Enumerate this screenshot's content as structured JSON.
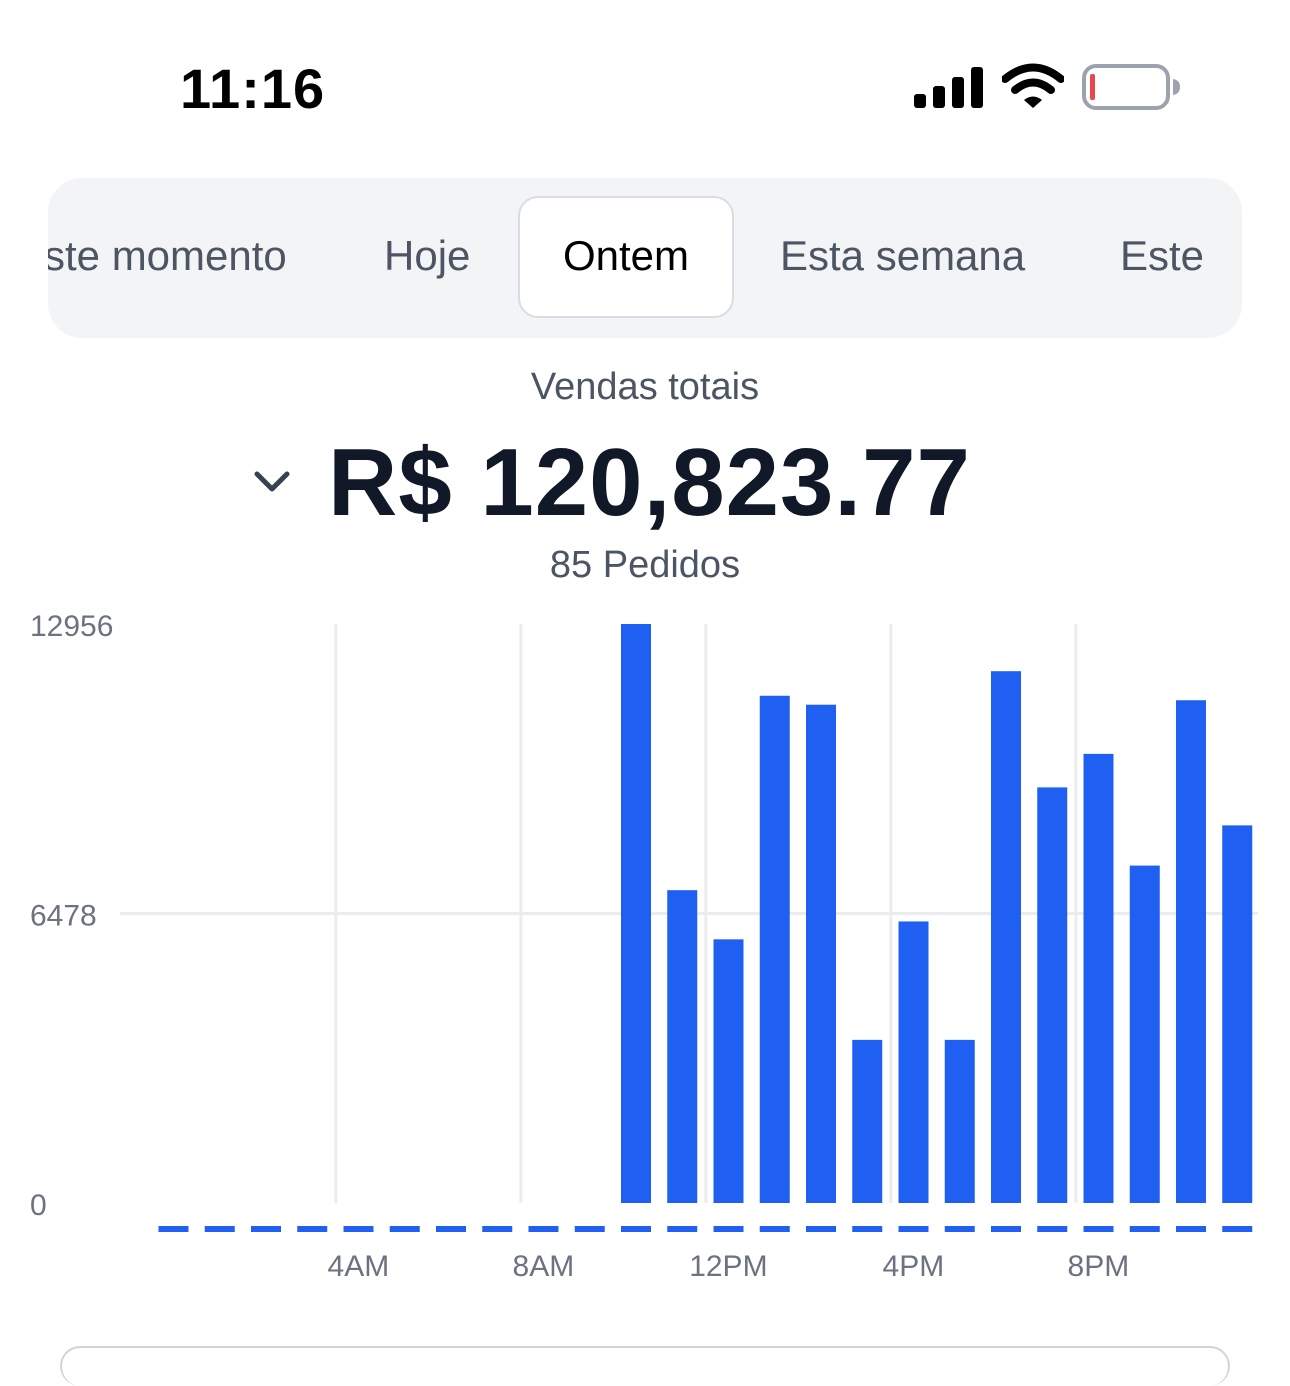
{
  "status_bar": {
    "time": "11:16",
    "icons": [
      "signal-bars-icon",
      "wifi-icon",
      "battery-low-icon"
    ],
    "battery_level": 0.05,
    "battery_color": "#e5484d"
  },
  "period_tabs": [
    {
      "label": "Este momento",
      "visible_text": "ste momento",
      "active": false
    },
    {
      "label": "Hoje",
      "visible_text": "Hoje",
      "active": false
    },
    {
      "label": "Ontem",
      "visible_text": "Ontem",
      "active": true
    },
    {
      "label": "Esta semana",
      "visible_text": "Esta semana",
      "active": false
    },
    {
      "label": "Este",
      "visible_text": "Este",
      "active": false
    }
  ],
  "summary": {
    "label": "Vendas totais",
    "value": "R$ 120,823.77",
    "orders": "85 Pedidos",
    "toggle_icon": "chevron-down-icon"
  },
  "colors": {
    "accent": "#1f5ff2",
    "grid": "#ececef",
    "muted_text": "#6b7280"
  },
  "chart_data": {
    "type": "bar",
    "x": [
      0,
      1,
      2,
      3,
      4,
      5,
      6,
      7,
      8,
      9,
      10,
      11,
      12,
      13,
      14,
      15,
      16,
      17,
      18,
      19,
      20,
      21,
      22,
      23
    ],
    "x_tick_labels": [
      {
        "at": 4,
        "label": "4AM"
      },
      {
        "at": 8,
        "label": "8AM"
      },
      {
        "at": 12,
        "label": "12PM"
      },
      {
        "at": 16,
        "label": "4PM"
      },
      {
        "at": 20,
        "label": "8PM"
      }
    ],
    "values": [
      0,
      0,
      0,
      0,
      0,
      0,
      0,
      0,
      0,
      0,
      12956,
      7000,
      5900,
      11350,
      11150,
      3650,
      6300,
      3650,
      11900,
      9300,
      10050,
      7550,
      11250,
      8450
    ],
    "y_ticks": [
      {
        "value": 0,
        "label": "0"
      },
      {
        "value": 6478,
        "label": "6478"
      },
      {
        "value": 12956,
        "label": "12956"
      }
    ],
    "ylim": [
      0,
      12956
    ],
    "title": "",
    "xlabel": "",
    "ylabel": "",
    "grid": true,
    "legend": "none"
  }
}
